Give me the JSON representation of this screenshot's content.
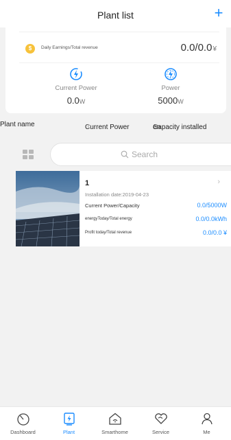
{
  "header": {
    "title": "Plant list",
    "add_label": "+"
  },
  "summary": {
    "earnings_label": "Daily Earnings/Total revenue",
    "earnings_value": "0.0/0.0",
    "earnings_unit": "¥",
    "current_power_label": "Current Power",
    "current_power_value": "0.0",
    "current_power_unit": "W",
    "power_label": "Power",
    "power_value": "5000",
    "power_unit": "W"
  },
  "columns": {
    "plant_name": "Plant name",
    "current_power": "Current Power",
    "capacity_installed": "Capacity installed",
    "overflow": "en"
  },
  "search": {
    "placeholder": "Search"
  },
  "plants": [
    {
      "name": "1",
      "installation_date": "Installation date:2019-04-23",
      "row1_label": "Current Power/Capacity",
      "row1_value": "0.0/5000W",
      "row2_label": "energyToday/Total energy",
      "row2_value": "0.0/0.0kWh",
      "row3_label": "Profit today/Total revenue",
      "row3_value": "0.0/0.0 ¥"
    }
  ],
  "tabs": [
    {
      "label": "Dashboard",
      "icon": "dashboard-icon"
    },
    {
      "label": "Plant",
      "icon": "plant-icon"
    },
    {
      "label": "Smarthome",
      "icon": "smarthome-icon"
    },
    {
      "label": "Service",
      "icon": "service-icon"
    },
    {
      "label": "Me",
      "icon": "me-icon"
    }
  ],
  "colors": {
    "accent": "#1a8cff",
    "coin": "#f7c23b",
    "background": "#f2f2f2"
  }
}
